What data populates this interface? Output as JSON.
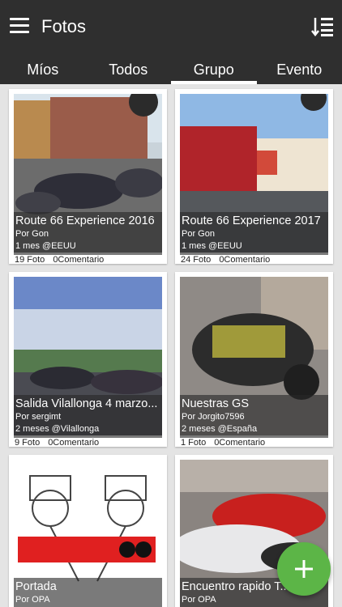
{
  "app": {
    "title": "Fotos"
  },
  "icons": {
    "menu": "hamburger-menu-icon",
    "sort": "sort-list-icon",
    "add": "plus-icon"
  },
  "colors": {
    "appbar": "#2f2f2f",
    "fab": "#5cb547",
    "background": "#e4e4e4"
  },
  "tabs": [
    {
      "label": "Míos"
    },
    {
      "label": "Todos"
    },
    {
      "label": "Grupo",
      "active": true
    },
    {
      "label": "Evento"
    }
  ],
  "albums": [
    {
      "name": "Route 66 Experience 2016",
      "by": "Por Gon",
      "ago": "1 mes @EEUU",
      "photos": "19 Foto",
      "comments": "0Comentario"
    },
    {
      "name": "Route 66 Experience 2017",
      "by": "Por Gon",
      "ago": "1 mes @EEUU",
      "photos": "24 Foto",
      "comments": "0Comentario"
    },
    {
      "name": "Salida Vilallonga 4 marzo...",
      "by": "Por sergimt",
      "ago": "2 meses @Vilallonga",
      "photos": "9 Foto",
      "comments": "0Comentario"
    },
    {
      "name": "Nuestras GS",
      "by": "Por Jorgito7596",
      "ago": "2 meses @España",
      "photos": "1 Foto",
      "comments": "0Comentario"
    },
    {
      "name": "Portada",
      "by": "Por OPA",
      "ago": "",
      "photos": "",
      "comments": ""
    },
    {
      "name": "Encuentro rapido T...",
      "by": "Por OPA",
      "ago": "",
      "photos": "",
      "comments": ""
    }
  ]
}
